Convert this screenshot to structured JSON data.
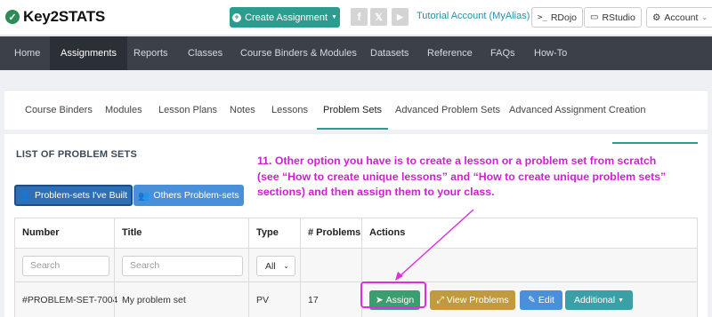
{
  "brand": {
    "name": "Key2STATS",
    "logo_icon": "check-circle-icon"
  },
  "header": {
    "create_button": "Create Assignment",
    "social_icons": [
      "facebook-icon",
      "x-twitter-icon",
      "youtube-icon"
    ],
    "tutorial_account": "Tutorial Account (MyAlias)",
    "rdojo": "RDojo",
    "rstudio": "RStudio",
    "account": "Account"
  },
  "nav": {
    "items": [
      "Home",
      "Assignments",
      "Reports",
      "Classes",
      "Course Binders & Modules",
      "Datasets",
      "Reference",
      "FAQs",
      "How-To"
    ],
    "active": "Assignments"
  },
  "subtabs": {
    "items": [
      "Course Binders",
      "Modules",
      "Lesson Plans",
      "Notes",
      "Lessons",
      "Problem Sets",
      "Advanced Problem Sets",
      "Advanced Assignment Creation"
    ],
    "active": "Problem Sets"
  },
  "main": {
    "title": "LIST OF PROBLEM SETS",
    "toggle_built": "Problem-sets I've Built",
    "toggle_others": "Others Problem-sets"
  },
  "table": {
    "headers": [
      "Number",
      "Title",
      "Type",
      "# Problems",
      "Actions"
    ],
    "search_placeholder_number": "Search",
    "search_placeholder_title": "Search",
    "type_filter": "All",
    "rows": [
      {
        "number": "#PROBLEM-SET-7004",
        "title": "My problem set",
        "type": "PV",
        "problems": "17"
      }
    ],
    "actions": {
      "assign": "Assign",
      "view": "View Problems",
      "edit": "Edit",
      "additional": "Additional"
    }
  },
  "annotation": {
    "text": "11. Other option you have is to create a lesson or a problem set from scratch (see “How to create unique lessons” and “How to create unique problem sets” sections) and then assign them to your class.",
    "color": "#d11ed1"
  },
  "colors": {
    "teal": "#2a9d8f",
    "nav_bg": "#3b4049",
    "primary_blue": "#2d6eb5",
    "gold": "#c29a3e",
    "info_blue": "#4a8fd9",
    "teal_dropdown": "#3aa0a8"
  }
}
